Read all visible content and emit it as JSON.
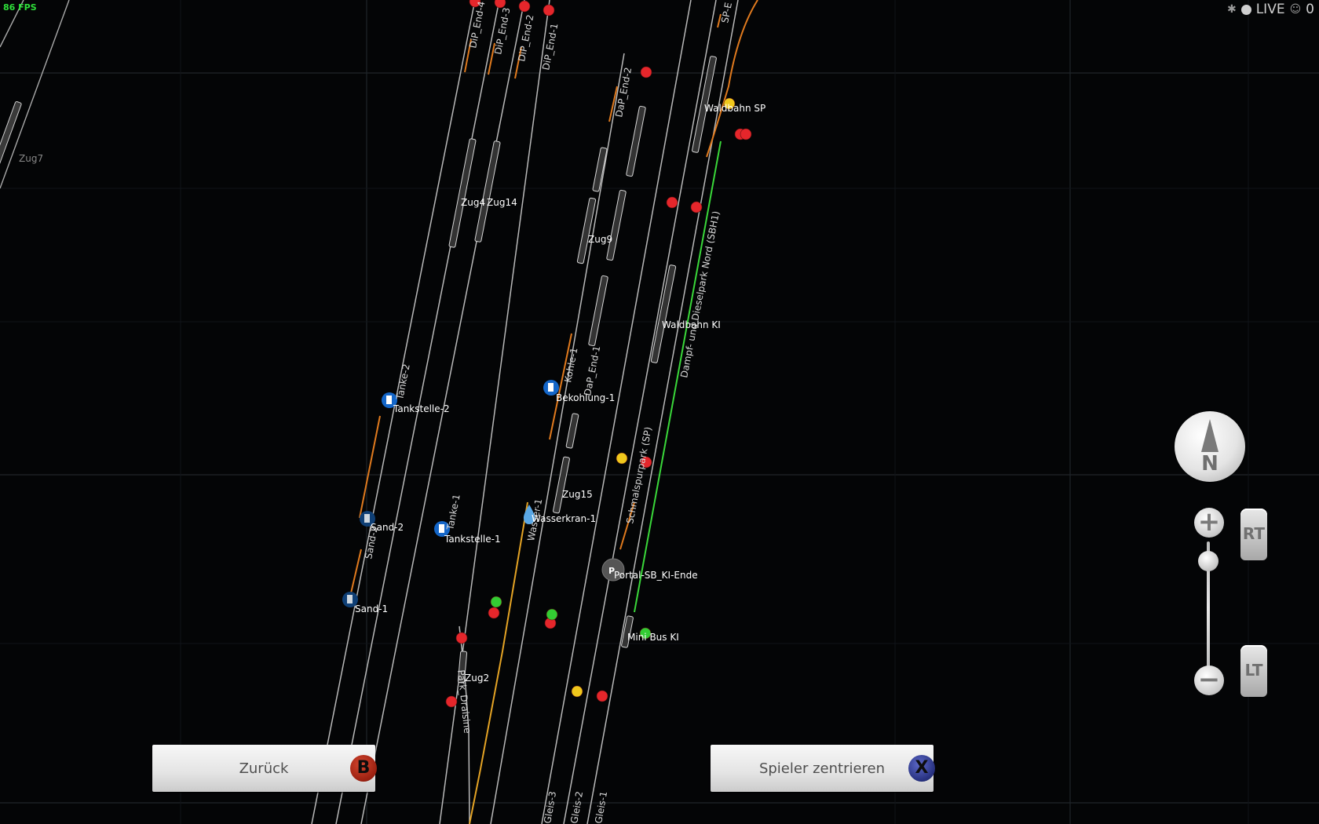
{
  "hud": {
    "fps": "86 FPS",
    "live": "LIVE",
    "players": "0"
  },
  "map": {
    "labels": {
      "dip_end_4": "DiP_End-4",
      "dip_end_3": "DiP_End-3",
      "dip_end_2": "DiP_End-2",
      "dip_end_1": "DiP_End-1",
      "sp_end": "SP-E",
      "dap_end_2": "DaP_End-2",
      "dap_end_1": "DaP_End-1",
      "waldbahn_sp": "Waldbahn SP",
      "zug7": "Zug7",
      "zug4": "Zug4",
      "zug14": "Zug14",
      "zug9": "Zug9",
      "zug15": "Zug15",
      "zug2": "Zug2",
      "waldbahn_ki": "Waldbahn KI",
      "dampf_dieselpark": "Dampf- und Dieselpark Nord (SBH1)",
      "schmalspurpark": "Schmalspurpark (SP)",
      "tanke_2": "Tanke-2",
      "tankstelle_2": "Tankstelle-2",
      "kohle_1": "Kohle-1",
      "bekohlung_1": "Bekohlung-1",
      "sand_2_track": "Sand-2",
      "sand_2": "Sand-2",
      "tanke_1": "Tanke-1",
      "tankstelle_1": "Tankstelle-1",
      "wasser_1": "Wasser-1",
      "wasserkran_1": "Wasserkran-1",
      "portal": "Portal-SB_KI-Ende",
      "sand_1": "Sand-1",
      "mini_bus": "Mini Bus KI",
      "park_draisine": "Park_Draisine",
      "gleis_3": "Gleis-3",
      "gleis_2": "Gleis-2",
      "gleis_1": "Gleis-1",
      "portal_icon": "P"
    }
  },
  "controls": {
    "compass_label": "N",
    "zoom_in": "+",
    "zoom_out": "−",
    "rt_label": "RT",
    "lt_label": "LT",
    "back_label": "Zurück",
    "back_key": "B",
    "center_label": "Spieler zentrieren",
    "center_key": "X"
  },
  "colors": {
    "track": "#b9b9b9",
    "section_orange": "#e07a1e",
    "section_green": "#3ad83a",
    "signal_red": "#e5262b",
    "signal_green": "#33cc33",
    "signal_yellow": "#f0c81c",
    "service_blue": "#1466c8",
    "button_b": "#b22a1a",
    "button_x": "#28328c"
  }
}
